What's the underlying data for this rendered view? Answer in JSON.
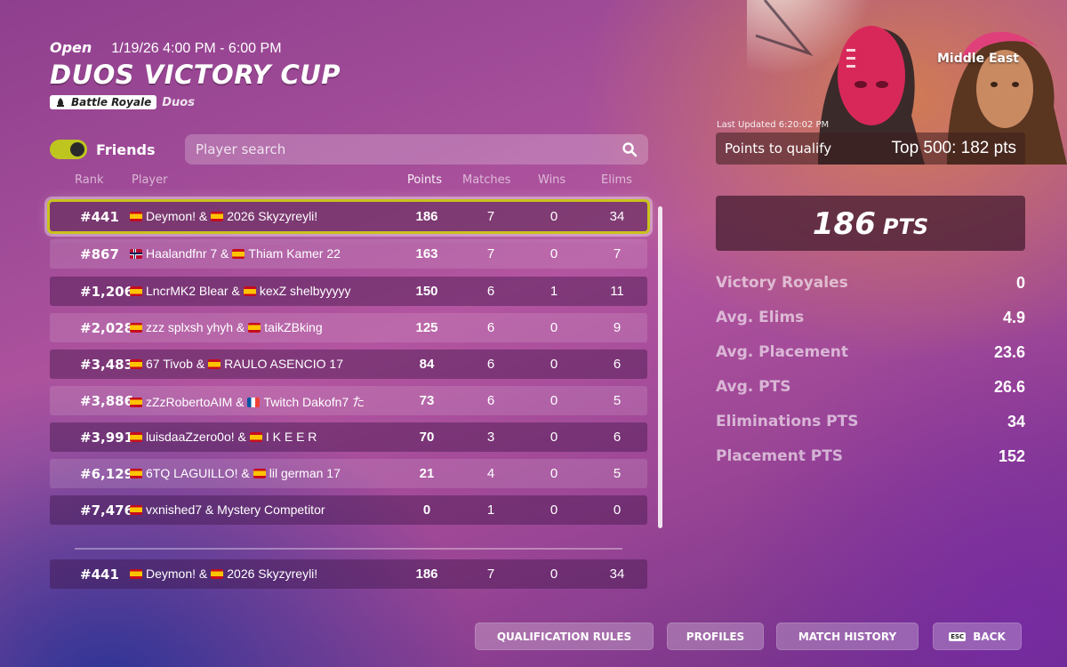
{
  "header": {
    "status": "Open",
    "time": "1/19/26 4:00 PM - 6:00 PM",
    "title": "DUOS VICTORY CUP",
    "mode_chip": "Battle Royale",
    "mode_sub": "Duos"
  },
  "filters": {
    "friends_label": "Friends",
    "friends_on": true,
    "search_placeholder": "Player search"
  },
  "table": {
    "columns": [
      "Rank",
      "Player",
      "Points",
      "Matches",
      "Wins",
      "Elims"
    ],
    "rows": [
      {
        "rank": "#441",
        "flag1": "es",
        "p1": "Deymon! & ",
        "flag2": "es",
        "p2": "2026 Skyzyreyli!",
        "points": "186",
        "matches": "7",
        "wins": "0",
        "elims": "34",
        "selected": true
      },
      {
        "rank": "#867",
        "flag1": "no",
        "p1": "Haalandfnr 7 & ",
        "flag2": "es",
        "p2": "Thiam Kamer 22",
        "points": "163",
        "matches": "7",
        "wins": "0",
        "elims": "7"
      },
      {
        "rank": "#1,206",
        "flag1": "es",
        "p1": "LncrMK2 Blear & ",
        "flag2": "es",
        "p2": "kexZ shelbyyyyy",
        "points": "150",
        "matches": "6",
        "wins": "1",
        "elims": "11"
      },
      {
        "rank": "#2,028",
        "flag1": "es",
        "p1": "zzz splxsh yhyh & ",
        "flag2": "es",
        "p2": "taikZBking",
        "points": "125",
        "matches": "6",
        "wins": "0",
        "elims": "9"
      },
      {
        "rank": "#3,483",
        "flag1": "es",
        "p1": "67 Tivob & ",
        "flag2": "es",
        "p2": "RAULO ASENCIO 17",
        "points": "84",
        "matches": "6",
        "wins": "0",
        "elims": "6"
      },
      {
        "rank": "#3,886",
        "flag1": "es",
        "p1": "zZzRobertoAIM & ",
        "flag2": "fr",
        "p2": "Twitch Dakofn7 た",
        "points": "73",
        "matches": "6",
        "wins": "0",
        "elims": "5"
      },
      {
        "rank": "#3,991",
        "flag1": "es",
        "p1": "luisdaaZzero0o! & ",
        "flag2": "es",
        "p2": "I K E E R",
        "points": "70",
        "matches": "3",
        "wins": "0",
        "elims": "6"
      },
      {
        "rank": "#6,129",
        "flag1": "es",
        "p1": "6TQ LAGUILLO! & ",
        "flag2": "es",
        "p2": "lil german 17",
        "points": "21",
        "matches": "4",
        "wins": "0",
        "elims": "5"
      },
      {
        "rank": "#7,476",
        "flag1": "es",
        "p1": "vxnished7 & Mystery Competitor",
        "flag2": "",
        "p2": "",
        "points": "0",
        "matches": "1",
        "wins": "0",
        "elims": "0"
      }
    ],
    "my_row": {
      "rank": "#441",
      "flag1": "es",
      "p1": "Deymon! & ",
      "flag2": "es",
      "p2": "2026 Skyzyreyli!",
      "points": "186",
      "matches": "7",
      "wins": "0",
      "elims": "34"
    }
  },
  "panel": {
    "region": "Middle East",
    "last_updated": "Last Updated 6:20:02 PM",
    "qualify_label": "Points to qualify",
    "qualify_value": "Top 500: 182 pts",
    "total_points": "186",
    "total_unit": "PTS",
    "stats": [
      {
        "label": "Victory Royales",
        "value": "0"
      },
      {
        "label": "Avg. Elims",
        "value": "4.9"
      },
      {
        "label": "Avg. Placement",
        "value": "23.6"
      },
      {
        "label": "Avg. PTS",
        "value": "26.6"
      },
      {
        "label": "Eliminations PTS",
        "value": "34"
      },
      {
        "label": "Placement PTS",
        "value": "152"
      }
    ]
  },
  "buttons": {
    "qualification_rules": "QUALIFICATION RULES",
    "profiles": "PROFILES",
    "match_history": "MATCH HISTORY",
    "back": "BACK",
    "esc_key": "ESC"
  },
  "icons": {
    "search": "search-icon",
    "battle_royale": "battle-royale-icon",
    "esc": "esc-key-icon"
  },
  "colors": {
    "accent_toggle": "#bfc51f",
    "selected_outline": "#c9c21c"
  }
}
